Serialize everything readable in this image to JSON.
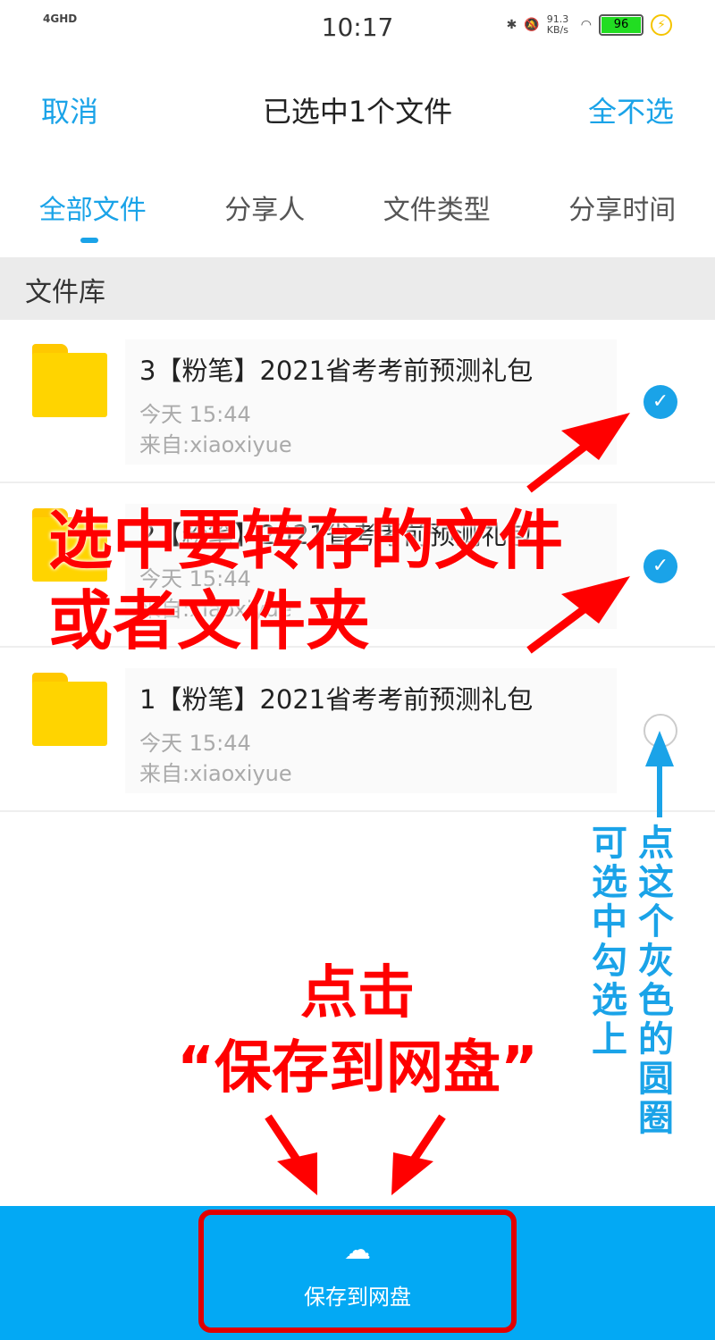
{
  "status": {
    "network": "4GHD",
    "time": "10:17",
    "speed": "91.3 KB/s",
    "battery": "96"
  },
  "header": {
    "cancel": "取消",
    "title": "已选中1个文件",
    "deselect_all": "全不选"
  },
  "tabs": [
    {
      "label": "全部文件",
      "active": true
    },
    {
      "label": "分享人"
    },
    {
      "label": "文件类型"
    },
    {
      "label": "分享时间"
    }
  ],
  "section": "文件库",
  "files": [
    {
      "name": "3【粉笔】2021省考考前预测礼包",
      "time": "今天 15:44",
      "from": "来自:xiaoxiyue",
      "selected": true
    },
    {
      "name": "2【粉笔】2021省考考前预测礼包",
      "time": "今天 15:44",
      "from": "来自:xiaoxiyue",
      "selected": true
    },
    {
      "name": "1【粉笔】2021省考考前预测礼包",
      "time": "今天 15:44",
      "from": "来自:xiaoxiyue",
      "selected": false
    }
  ],
  "annotations": {
    "select_line1": "选中要转存的文件",
    "select_line2": "或者文件夹",
    "click_line1": "点击",
    "click_line2": "“保存到网盘”",
    "hint_col1": "点这个灰色的圆圈",
    "hint_col2": "可选中 勾选上"
  },
  "bottom": {
    "save_label": "保存到网盘"
  }
}
